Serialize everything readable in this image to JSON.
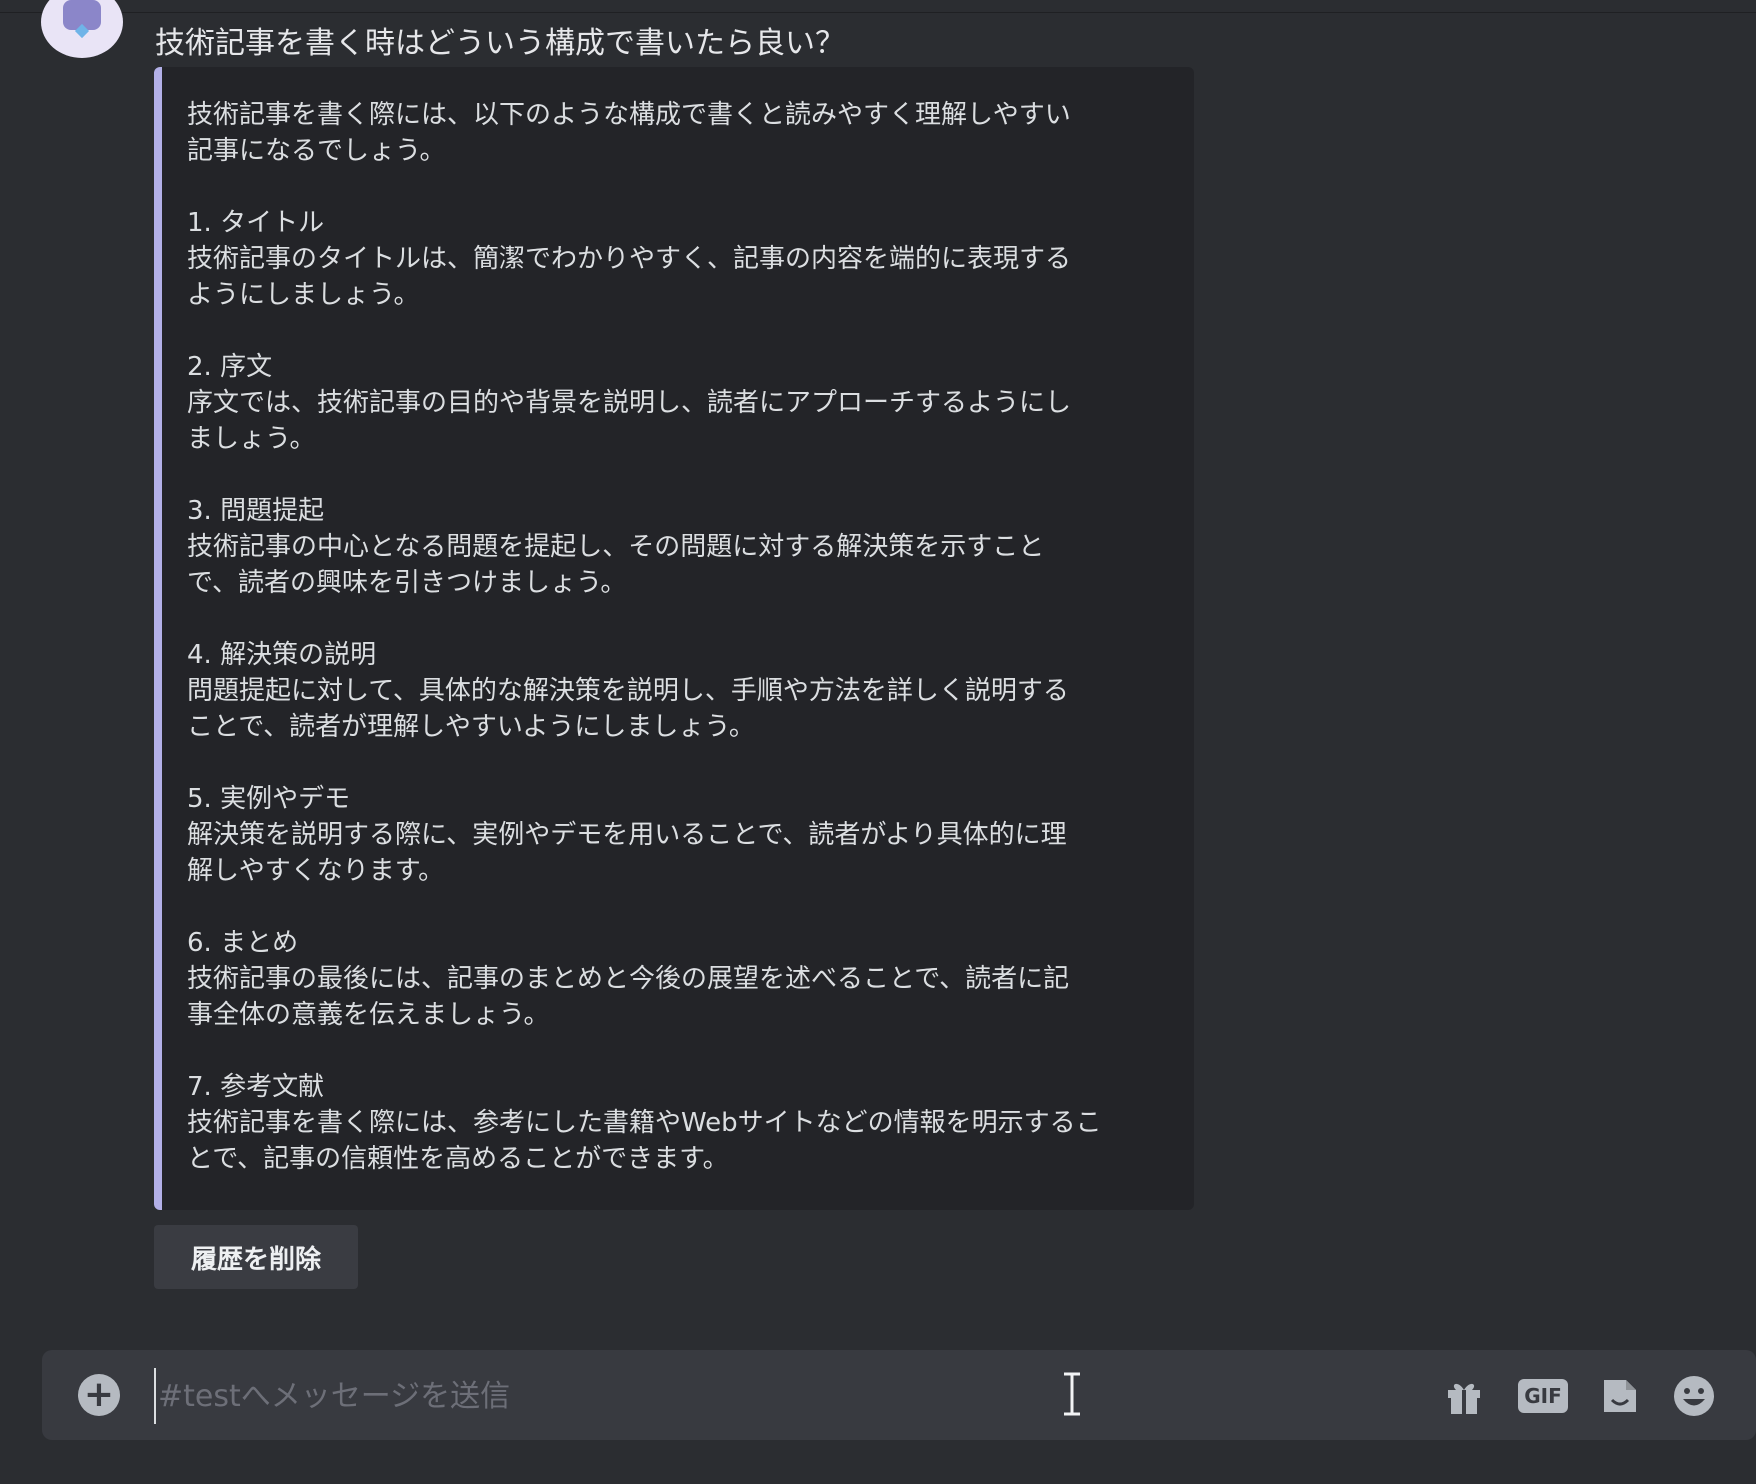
{
  "message": {
    "question": "技術記事を書く時はどういう構成で書いたら良い？"
  },
  "embed": {
    "paragraphs": [
      [
        "技術記事を書く際には、以下のような構成で書くと読みやすく理解しやすい",
        "記事になるでしょう。"
      ],
      [
        "1. タイトル",
        "技術記事のタイトルは、簡潔でわかりやすく、記事の内容を端的に表現する",
        "ようにしましょう。"
      ],
      [
        "2. 序文",
        "序文では、技術記事の目的や背景を説明し、読者にアプローチするようにし",
        "ましょう。"
      ],
      [
        "3. 問題提起",
        "技術記事の中心となる問題を提起し、その問題に対する解決策を示すこと",
        "で、読者の興味を引きつけましょう。"
      ],
      [
        "4. 解決策の説明",
        "問題提起に対して、具体的な解決策を説明し、手順や方法を詳しく説明する",
        "ことで、読者が理解しやすいようにしましょう。"
      ],
      [
        "5. 実例やデモ",
        "解決策を説明する際に、実例やデモを用いることで、読者がより具体的に理",
        "解しやすくなります。"
      ],
      [
        "6. まとめ",
        "技術記事の最後には、記事のまとめと今後の展望を述べることで、読者に記",
        "事全体の意義を伝えましょう。"
      ],
      [
        "7. 参考文献",
        "技術記事を書く際には、参考にした書籍やWebサイトなどの情報を明示するこ",
        "とで、記事の信頼性を高めることができます。"
      ]
    ],
    "accent_color": "#b3b0e8"
  },
  "actions": {
    "delete_history_label": "履歴を削除"
  },
  "composer": {
    "placeholder": "#testへメッセージを送信",
    "value": "",
    "icons": [
      "plus-circle-icon",
      "text-cursor-icon",
      "gift-icon",
      "gif-icon",
      "sticker-icon",
      "emoji-icon"
    ],
    "gif_label": "GIF"
  },
  "colors": {
    "background": "#2b2d31",
    "embed_background": "#232428",
    "composer_background": "#383a40"
  }
}
